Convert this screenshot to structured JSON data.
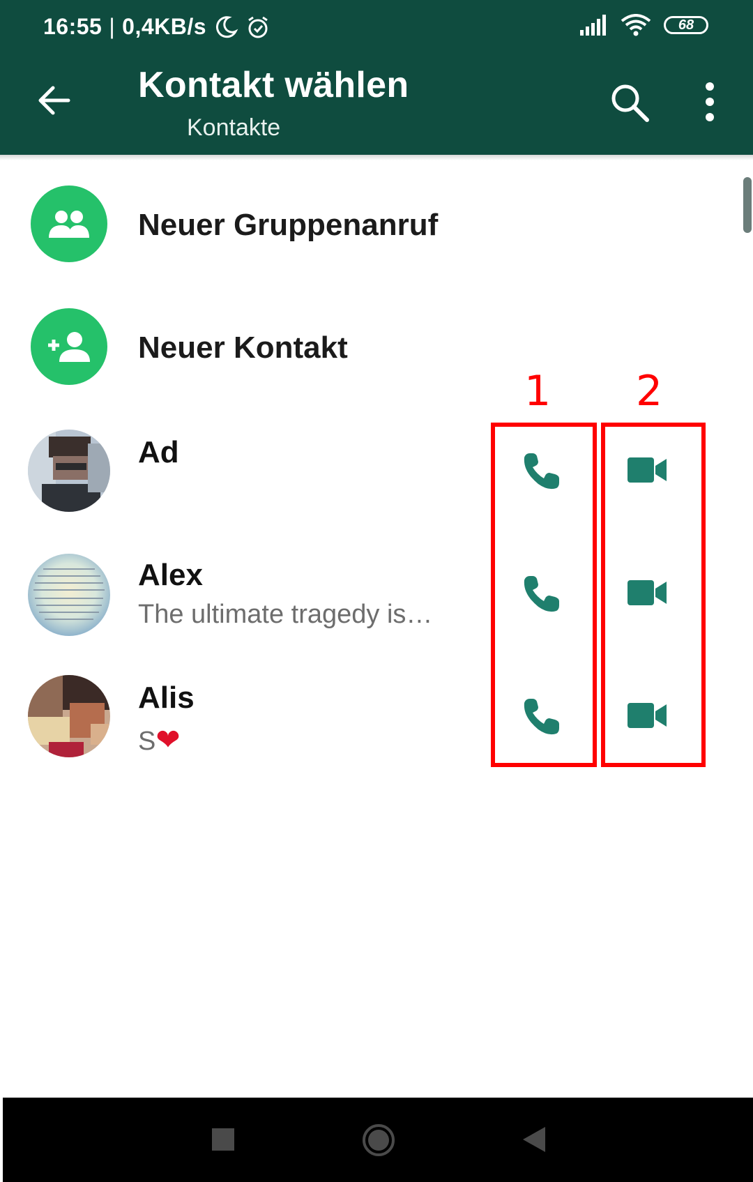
{
  "status_bar": {
    "time": "16:55",
    "separator": "|",
    "net_speed": "0,4KB/s",
    "battery": "68",
    "icons": [
      "moon-icon",
      "alarm-icon",
      "signal-icon",
      "wifi-icon",
      "battery-icon"
    ]
  },
  "app_bar": {
    "title": "Kontakt wählen",
    "subtitle": "Kontakte",
    "icons": [
      "back-arrow-icon",
      "search-icon",
      "more-vert-icon"
    ]
  },
  "actions": [
    {
      "label": "Neuer Gruppenanruf",
      "icon": "group-icon"
    },
    {
      "label": "Neuer Kontakt",
      "icon": "add-person-icon"
    }
  ],
  "contacts": [
    {
      "name": "Ad",
      "status": ""
    },
    {
      "name": "Alex",
      "status": "The ultimate tragedy is…"
    },
    {
      "name": "Alis",
      "status": "S",
      "status_emoji": "❤"
    }
  ],
  "annotations": {
    "label_1": "1",
    "label_2": "2",
    "color": "#ff0000"
  },
  "colors": {
    "primary_dark": "#0f4c3f",
    "accent_green": "#25c16a",
    "call_icon": "#1f7f6d"
  }
}
